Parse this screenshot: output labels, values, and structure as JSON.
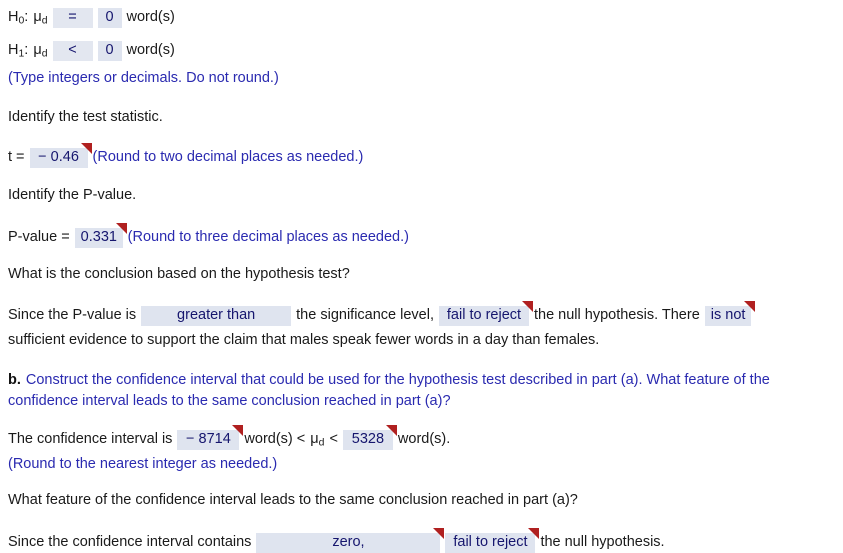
{
  "hypotheses": {
    "h0_label": "H",
    "h0_sub": "0",
    "h0_param": "μ",
    "h0_param_sub": "d",
    "h0_operator": "=",
    "h0_value": "0",
    "h0_units": "word(s)",
    "h1_label": "H",
    "h1_sub": "1",
    "h1_param": "μ",
    "h1_param_sub": "d",
    "h1_operator": "<",
    "h1_value": "0",
    "h1_units": "word(s)",
    "type_note": "(Type integers or decimals. Do not round.)"
  },
  "test_statistic": {
    "prompt": "Identify the test statistic.",
    "label": "t =",
    "value": "− 0.46",
    "round_note": "(Round to two decimal places as needed.)"
  },
  "p_value": {
    "prompt": "Identify the P-value.",
    "label": "P-value =",
    "value": "0.331",
    "round_note": "(Round to three decimal places as needed.)"
  },
  "conclusion": {
    "question": "What is the conclusion based on the hypothesis test?",
    "text_1": "Since the P-value is",
    "comparison": "greater than",
    "text_2": "the significance level,",
    "decision": "fail to reject",
    "text_3": "the null hypothesis. There",
    "evidence": "is not",
    "text_4": "sufficient evidence to support the claim that males speak fewer words in a day than females."
  },
  "part_b": {
    "marker": "b.",
    "text": "Construct the confidence interval that could be used for the hypothesis test described in part (a). What feature of the confidence interval leads to the same conclusion reached in part (a)?"
  },
  "confidence_interval": {
    "label": "The confidence interval is",
    "lower": "− 8714",
    "units_1": "word(s) <",
    "param": "μ",
    "param_sub": "d",
    "less_than": "<",
    "upper": "5328",
    "units_2": "word(s).",
    "round_note": "(Round to the nearest integer as needed.)"
  },
  "feature": {
    "question": "What feature of the confidence interval leads to the same conclusion reached in part (a)?",
    "text_1": "Since the confidence interval contains",
    "contains": "zero,",
    "decision": "fail to reject",
    "text_2": "the null hypothesis."
  },
  "colors": {
    "field_bg": "#dfe4ef",
    "field_text": "#16166e",
    "instruction_blue": "#2a2ab0",
    "body_text": "#1a1a1a",
    "flag_red": "#b02020"
  }
}
